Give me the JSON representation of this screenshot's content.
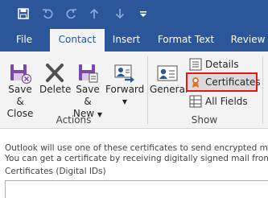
{
  "quick_access": {
    "icons": [
      "save-icon",
      "undo-icon",
      "redo-icon",
      "up-arrow-icon",
      "down-arrow-icon",
      "customize-icon"
    ]
  },
  "tabs": [
    {
      "label": "File",
      "active": false
    },
    {
      "label": "Contact",
      "active": true
    },
    {
      "label": "Insert",
      "active": false
    },
    {
      "label": "Format Text",
      "active": false
    },
    {
      "label": "Review",
      "active": false
    }
  ],
  "ribbon": {
    "actions": {
      "group_label": "Actions",
      "save_close_line1": "Save &",
      "save_close_line2": "Close",
      "delete": "Delete",
      "save_new_line1": "Save &",
      "save_new_line2": "New",
      "forward": "Forward"
    },
    "show": {
      "group_label": "Show",
      "general": "General",
      "details": "Details",
      "certificates": "Certificates",
      "all_fields": "All Fields"
    }
  },
  "message": {
    "line1": "Outlook will use one of these certificates to send encrypted mail to this contact.",
    "line2": "You can get a certificate by receiving digitally signed mail from this contact."
  },
  "certificates": {
    "label": "Certificates (Digital IDs)"
  },
  "colors": {
    "title_bar": "#2b579a",
    "ribbon_bg": "#f3f3f3",
    "highlight_border": "#e8151d",
    "accent_purple": "#7b4aa8",
    "accent_blue": "#2b579a"
  }
}
